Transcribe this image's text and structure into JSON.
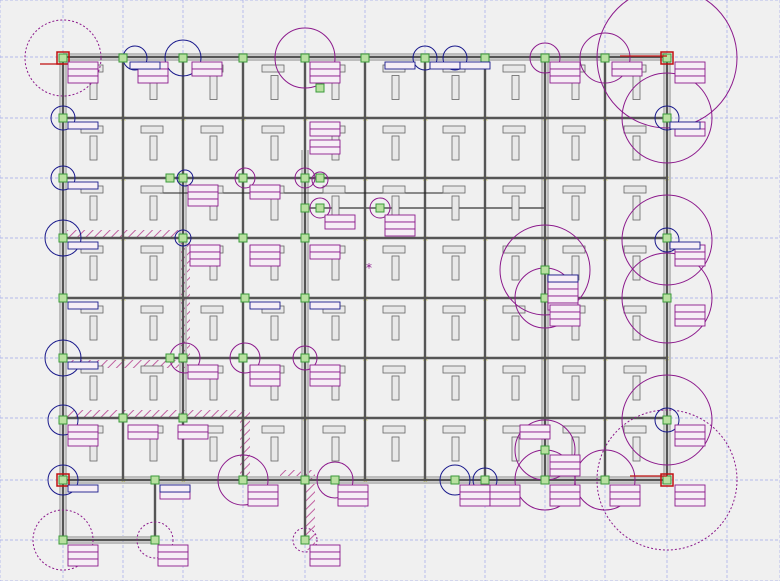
{
  "view": {
    "background": "#f0f0f0",
    "grid_color": "#a0a8e8",
    "beam_color": "#555555",
    "beam_light_color": "#bdbdbd",
    "column_green": "#3a9a3a",
    "column_fill": "#b8e0a0",
    "circle_blue": "#1a1a8c",
    "circle_purple": "#8c1a8c",
    "label_purple": "#8c1a8c",
    "label_blue": "#1a1a8c",
    "hatch_color": "#c060a0",
    "accent_red": "#c01010",
    "marker_yellow": "#d8d860"
  },
  "annotation": {
    "cursor_mark": "*"
  },
  "icons": {
    "node_marker": "column-node-icon",
    "crosshair": "crosshair-icon"
  }
}
